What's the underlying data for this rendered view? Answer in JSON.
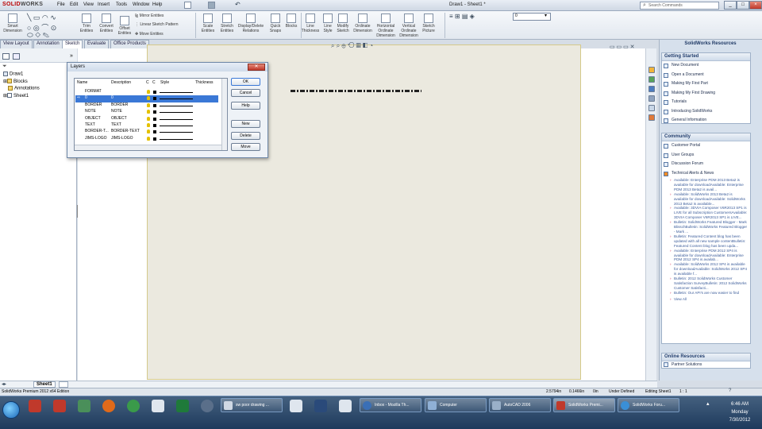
{
  "app": {
    "logo_solid": "SOLID",
    "logo_works": "WORKS",
    "doc_title": "Draw1 - Sheet1 *"
  },
  "menu": [
    "File",
    "Edit",
    "View",
    "Insert",
    "Tools",
    "Window",
    "Help"
  ],
  "search": {
    "placeholder": "Search Commands"
  },
  "ribbon": {
    "buttons": [
      {
        "label1": "Smart",
        "label2": "Dimension"
      },
      {
        "label1": "Trim",
        "label2": "Entities"
      },
      {
        "label1": "Convert",
        "label2": "Entities"
      },
      {
        "label1": "Offset",
        "label2": "Entities"
      },
      {
        "label1": "Scale",
        "label2": "Entities"
      },
      {
        "label1": "Stretch",
        "label2": "Entities"
      },
      {
        "label1": "Display/Delete",
        "label2": "Relations"
      },
      {
        "label1": "Quick",
        "label2": "Snaps"
      },
      {
        "label1": "Blocks",
        "label2": ""
      },
      {
        "label1": "Line",
        "label2": "Thickness"
      },
      {
        "label1": "Line",
        "label2": "Style"
      },
      {
        "label1": "Modify",
        "label2": "Sketch"
      },
      {
        "label1": "Ordinate",
        "label2": "Dimension"
      },
      {
        "label1": "Horizontal",
        "label2": "Ordinate Dimension"
      },
      {
        "label1": "Vertical",
        "label2": "Ordinate Dimension"
      },
      {
        "label1": "Sketch",
        "label2": "Picture"
      }
    ],
    "small": [
      "Mirror Entities",
      "Linear Sketch Pattern",
      "Move Entities"
    ],
    "dropdown_value": "0"
  },
  "tabs": [
    "View Layout",
    "Annotation",
    "Sketch",
    "Evaluate",
    "Office Products"
  ],
  "tree": {
    "root": "Draw1",
    "items": [
      "Blocks",
      "Annotations",
      "Sheet1"
    ]
  },
  "sheet_tab": "Sheet1",
  "dialog": {
    "title": "Layers",
    "columns": [
      "Name",
      "Description",
      "C",
      "C",
      "Style",
      "Thickness"
    ],
    "rows": [
      {
        "name": "FORMAT",
        "desc": ""
      },
      {
        "name": "0",
        "desc": "0"
      },
      {
        "name": "BORDER",
        "desc": "BORDER"
      },
      {
        "name": "NOTE",
        "desc": "NOTE"
      },
      {
        "name": "OBJECT",
        "desc": "OBJECT"
      },
      {
        "name": "TEXT",
        "desc": "TEXT"
      },
      {
        "name": "BORDER-T...",
        "desc": "BORDER-TEXT"
      },
      {
        "name": "JIMS-LOGO",
        "desc": "JIMS-LOGO"
      }
    ],
    "buttons": [
      "OK",
      "Cancel",
      "Help",
      "New",
      "Delete",
      "Move"
    ]
  },
  "resources": {
    "title": "SolidWorks Resources",
    "getting_started": {
      "title": "Getting Started",
      "items": [
        "New Document",
        "Open a Document",
        "Making My First Part",
        "Making My First Drawing",
        "Tutorials",
        "Introducing SolidWorks",
        "General Information"
      ]
    },
    "community": {
      "title": "Community",
      "items": [
        "Customer Portal",
        "User Groups",
        "Discussion Forum",
        "Technical Alerts & News"
      ]
    },
    "news": [
      "Available: Enterprise PDM 2013 Beta2 is available for downloadAvailable: Enterprise PDM 2013 Beta2 is avail...",
      "Available: SolidWorks 2013 Beta2 is available for downloadAvailable: SolidWorks 2013 Beta2 is available...",
      "Available: 3DVIA Composer V6R2013 SP1 is LIVE for all Subscription CustomersAvailable: 3DVIA Composer V6R2013 SP1 is LIVE...",
      "Bulletin: SolidWorks Featured Blogger - Mark BlisschBulletin: SolidWorks Featured Blogger - Mark ...",
      "Bulletin: Featured Content blog has been updated with all new sample contentBulletin: Featured Content blog has been upda...",
      "Available: Enterprise PDM 2012 SP4 is available for downloadAvailable: Enterprise PDM 2012 SP4 is availab...",
      "Available: SolidWorks 2012 SP4 is available for downloadAvailable: SolidWorks 2012 SP4 is available f...",
      "Bulletin: 2012 SolidWorks Customer Satisfaction SurveyBulletin: 2012 SolidWorks Customer Satisfacti...",
      "Bulletin: Our API's are now easier to find"
    ],
    "view_all": "View All",
    "online": {
      "title": "Online Resources",
      "items": [
        "Partner Solutions"
      ]
    }
  },
  "status": {
    "left": "SolidWorks Premium 2012 x64 Edition",
    "x": "2.5794in",
    "y": "0.1466in",
    "z": "0in",
    "state": "Under Defined",
    "editing": "Editing Sheet1",
    "scale": "1 : 1"
  },
  "taskbar": {
    "tasks": [
      {
        "label": "sw poor drawing ..."
      },
      {
        "label": "Inbox - Mozilla Th..."
      },
      {
        "label": "Computer"
      },
      {
        "label": "AutoCAD 2006"
      },
      {
        "label": "SolidWorks Premi..."
      },
      {
        "label": "SolidWorks Foru..."
      }
    ],
    "time": "6:46 AM",
    "day": "Monday",
    "date": "7/30/2012"
  },
  "colors": {
    "selection": "#3a78d6",
    "brand": "#b00000",
    "taskbar": "#1e3a5c"
  }
}
